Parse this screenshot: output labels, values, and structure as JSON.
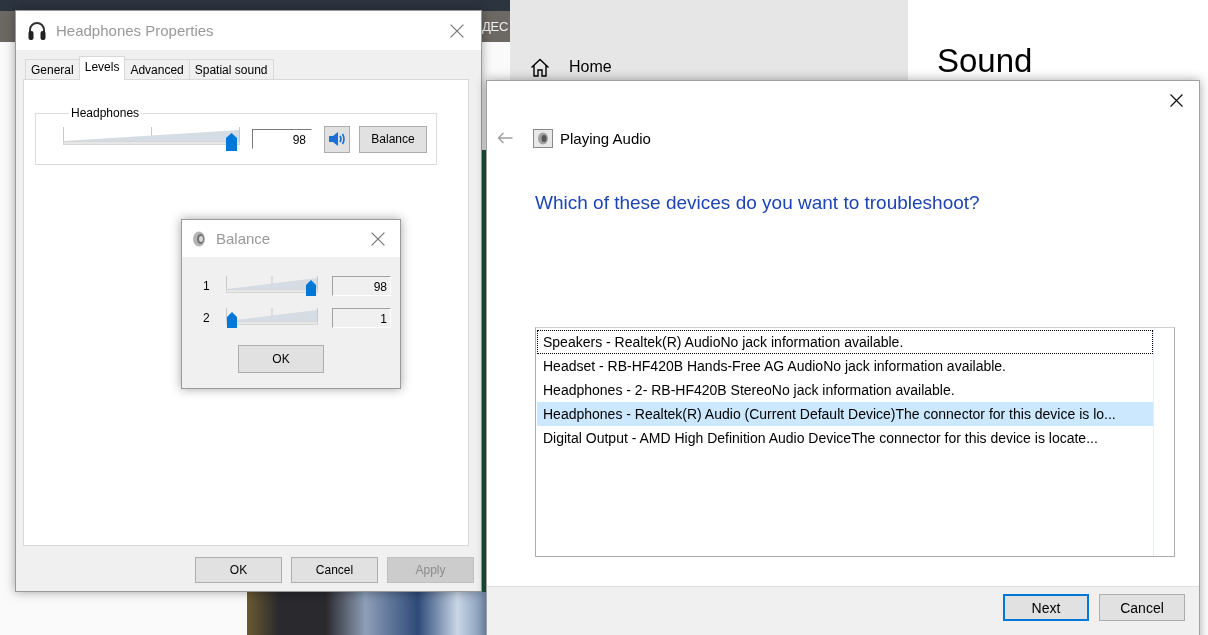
{
  "background": {
    "header_text": "ДЕС"
  },
  "settings": {
    "nav_items": [
      {
        "label": "Home"
      }
    ],
    "page_title": "Sound"
  },
  "properties": {
    "title": "Headphones Properties",
    "tabs": [
      {
        "label": "General",
        "selected": false
      },
      {
        "label": "Levels",
        "selected": true
      },
      {
        "label": "Advanced",
        "selected": false
      },
      {
        "label": "Spatial sound",
        "selected": false
      }
    ],
    "group_label": "Headphones",
    "volume": {
      "level": 0.98,
      "value": "98",
      "muted": false
    },
    "balance_button": "Balance",
    "buttons": [
      {
        "label": "OK",
        "disabled": false
      },
      {
        "label": "Cancel",
        "disabled": false
      },
      {
        "label": "Apply",
        "disabled": true
      }
    ]
  },
  "balance": {
    "title": "Balance",
    "channels": [
      {
        "label": "1",
        "level": 0.98,
        "value": "98"
      },
      {
        "label": "2",
        "level": 0.01,
        "value": "1"
      }
    ],
    "button": "OK"
  },
  "troubleshooter": {
    "breadcrumb": "Playing Audio",
    "question": "Which of these devices do you want to troubleshoot?",
    "devices": [
      {
        "label": "Speakers - Realtek(R) AudioNo jack information available.",
        "selected": false,
        "focused": true
      },
      {
        "label": "Headset - RB-HF420B Hands-Free AG AudioNo jack information available.",
        "selected": false,
        "focused": false
      },
      {
        "label": "Headphones - 2- RB-HF420B StereoNo jack information available.",
        "selected": false,
        "focused": false
      },
      {
        "label": "Headphones - Realtek(R) Audio (Current Default Device)The connector for this device is lo...",
        "selected": true,
        "focused": false
      },
      {
        "label": "Digital Output - AMD High Definition Audio DeviceThe connector for this device is locate...",
        "selected": false,
        "focused": false
      }
    ],
    "buttons": [
      {
        "label": "Next",
        "default": true
      },
      {
        "label": "Cancel",
        "default": false
      }
    ]
  }
}
